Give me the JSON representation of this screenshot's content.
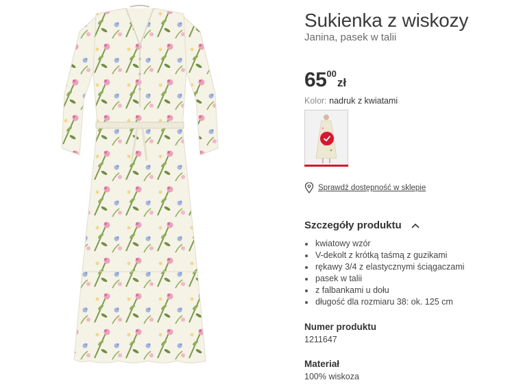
{
  "product": {
    "brand_tag": "Janina",
    "title": "Sukienka z wiskozy",
    "subtitle": "Janina, pasek w talii",
    "price": {
      "integer": "65",
      "decimal": "00",
      "currency": "zł"
    },
    "color": {
      "label": "Kolor:",
      "value": "nadruk z kwiatami"
    },
    "store_link": "Sprawdź dostępność w sklepie"
  },
  "details": {
    "heading": "Szczegóły produktu",
    "bullets": [
      "kwiatowy wzór",
      "V-dekolt z krótką taśmą z guzikami",
      "rękawy 3/4 z elastycznymi ściągaczami",
      "pasek w talii",
      "z falbankami u dołu",
      "długość dla rozmiaru 38: ok. 125 cm"
    ]
  },
  "product_number": {
    "label": "Numer produktu",
    "value": "1211647"
  },
  "material": {
    "label": "Materiał",
    "value": "100% wiskoza"
  },
  "icons": {
    "location": "map-pin-icon",
    "collapse": "chevron-up-icon",
    "selected": "check-icon"
  },
  "colors": {
    "accent": "#d7172f",
    "text": "#333333",
    "muted": "#8a8a8a"
  }
}
